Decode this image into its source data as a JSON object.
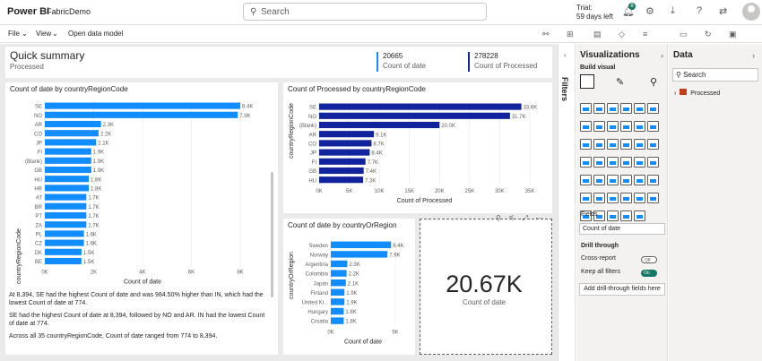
{
  "app": {
    "name": "Power BI",
    "workspace": "FabricDemo",
    "search_placeholder": "Search",
    "trial_line1": "Trial:",
    "trial_line2": "59 days left",
    "notifications": "8"
  },
  "menu": {
    "file": "File",
    "view": "View",
    "open_model": "Open data model"
  },
  "quick_summary": {
    "title": "Quick summary",
    "subtitle": "Processed",
    "kpis": [
      {
        "value": "20665",
        "label": "Count of date",
        "color": "#118dff"
      },
      {
        "value": "278228",
        "label": "Count of Processed",
        "color": "#12239e"
      }
    ]
  },
  "chart1_title": "Count of date by countryRegionCode",
  "chart2_title": "Count of Processed by countryRegionCode",
  "chart3_title": "Count of date by countryOrRegion",
  "kpi_card": {
    "value": "20.67K",
    "label": "Count of date"
  },
  "narrative": [
    "At 8,394, SE had the highest Count of date and was 984.50% higher than IN, which had the lowest Count of date at 774.",
    "SE had the highest Count of date at 8,394, followed by NO and AR. IN had the lowest Count of date at 774.",
    "Across all 35 countryRegionCode, Count of date ranged from 774 to 8,394."
  ],
  "chart_data": [
    {
      "type": "bar",
      "orientation": "horizontal",
      "title": "Count of date by countryRegionCode",
      "xlabel": "Count of date",
      "ylabel": "countryRegionCode",
      "color": "#118dff",
      "categories": [
        "SE",
        "NO",
        "AR",
        "CO",
        "JP",
        "FI",
        "(Blank)",
        "GB",
        "HU",
        "HR",
        "AT",
        "BR",
        "PT",
        "ZA",
        "PL",
        "CZ",
        "DK",
        "BE"
      ],
      "values": [
        8400,
        7900,
        2300,
        2200,
        2100,
        1900,
        1900,
        1900,
        1800,
        1800,
        1700,
        1700,
        1700,
        1700,
        1600,
        1600,
        1500,
        1500
      ],
      "labels": [
        "8.4K",
        "7.9K",
        "2.3K",
        "2.2K",
        "2.1K",
        "1.9K",
        "1.9K",
        "1.9K",
        "1.8K",
        "1.8K",
        "1.7K",
        "1.7K",
        "1.7K",
        "1.7K",
        "1.6K",
        "1.6K",
        "1.5K",
        "1.5K"
      ],
      "xticks": [
        "0K",
        "2K",
        "4K",
        "6K",
        "8K"
      ],
      "xlim": [
        0,
        8000
      ]
    },
    {
      "type": "bar",
      "orientation": "horizontal",
      "title": "Count of Processed by countryRegionCode",
      "xlabel": "Count of Processed",
      "ylabel": "countryRegionCode",
      "color": "#12239e",
      "categories": [
        "SE",
        "NO",
        "(Blank)",
        "AR",
        "CO",
        "JP",
        "FI",
        "GB",
        "HU"
      ],
      "values": [
        33600,
        31700,
        20000,
        9100,
        8700,
        8400,
        7700,
        7400,
        7300
      ],
      "labels": [
        "33.6K",
        "31.7K",
        "20.0K",
        "9.1K",
        "8.7K",
        "8.4K",
        "7.7K",
        "7.4K",
        "7.3K"
      ],
      "xticks": [
        "0K",
        "5K",
        "10K",
        "15K",
        "20K",
        "25K",
        "30K",
        "35K"
      ],
      "xlim": [
        0,
        35000
      ]
    },
    {
      "type": "bar",
      "orientation": "horizontal",
      "title": "Count of date by countryOrRegion",
      "xlabel": "Count of date",
      "ylabel": "countryOrRegion",
      "color": "#118dff",
      "categories": [
        "Sweden",
        "Norway",
        "Argentina",
        "Colombia",
        "Japan",
        "Finland",
        "United Ki...",
        "Hungary",
        "Croatia"
      ],
      "values": [
        8400,
        7900,
        2300,
        2200,
        2100,
        1900,
        1900,
        1800,
        1800
      ],
      "labels": [
        "8.4K",
        "7.9K",
        "2.3K",
        "2.2K",
        "2.1K",
        "1.9K",
        "1.9K",
        "1.8K",
        "1.8K"
      ],
      "xticks": [
        "0K",
        "5K"
      ],
      "xlim": [
        0,
        9000
      ]
    }
  ],
  "viz_pane": {
    "title": "Visualizations",
    "build": "Build visual",
    "fields_label": "Fields",
    "field_well": "Count of date",
    "drill_through": "Drill through",
    "cross_report": "Cross-report",
    "cross_state": "Off",
    "keep_filters": "Keep all filters",
    "keep_state": "On",
    "add_button": "Add drill-through fields here"
  },
  "filters_label": "Filters",
  "data_pane": {
    "title": "Data",
    "search_placeholder": "Search",
    "table": "Processed"
  }
}
